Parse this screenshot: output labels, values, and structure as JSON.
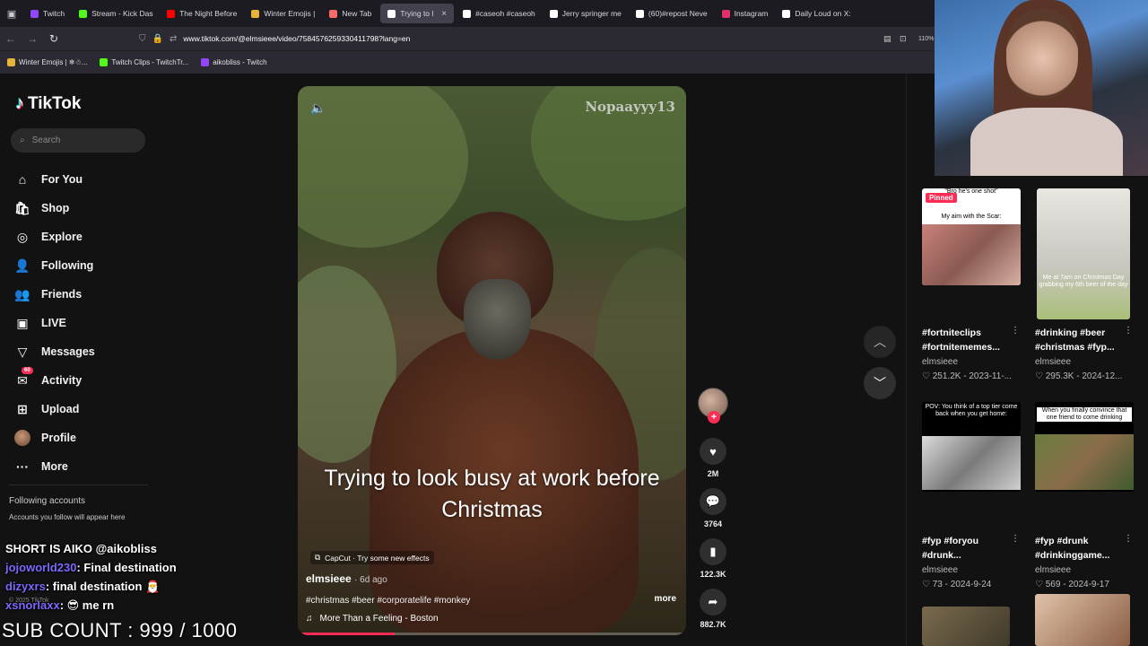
{
  "browser": {
    "tabs": [
      {
        "label": "Twitch",
        "color": "#9146ff",
        "active": false
      },
      {
        "label": "Stream - Kick Das",
        "color": "#53fc18",
        "active": false
      },
      {
        "label": "The Night Before",
        "color": "#ff0000",
        "active": false
      },
      {
        "label": "Winter Emojis |",
        "color": "#e8b339",
        "active": false
      },
      {
        "label": "New Tab",
        "color": "#ff6a6a",
        "active": false
      },
      {
        "label": "Trying to l",
        "color": "#ffffff",
        "active": true
      },
      {
        "label": "#caseoh #caseoh",
        "color": "#ffffff",
        "active": false
      },
      {
        "label": "Jerry springer me",
        "color": "#ffffff",
        "active": false
      },
      {
        "label": "(60)#repost Neve",
        "color": "#ffffff",
        "active": false
      },
      {
        "label": "Instagram",
        "color": "#e1306c",
        "active": false
      },
      {
        "label": "Daily Loud on X:",
        "color": "#ffffff",
        "active": false
      }
    ],
    "url": "www.tiktok.com/@elmsieee/video/7584576259330411798?lang=en",
    "zoom": "110%",
    "bookmarks": [
      {
        "label": "Winter Emojis | ❄☃...",
        "color": "#e8b339"
      },
      {
        "label": "Twitch Clips - TwitchTr...",
        "color": "#53fc18"
      },
      {
        "label": "aikobliss - Twitch",
        "color": "#9146ff"
      }
    ]
  },
  "tiktok": {
    "logo": "TikTok",
    "search_placeholder": "Search",
    "menu": [
      {
        "label": "For You",
        "icon": "home-icon",
        "glyph": "⌂"
      },
      {
        "label": "Shop",
        "icon": "shop-icon",
        "glyph": "🛍"
      },
      {
        "label": "Explore",
        "icon": "compass-icon",
        "glyph": "◎"
      },
      {
        "label": "Following",
        "icon": "following-icon",
        "glyph": "👤"
      },
      {
        "label": "Friends",
        "icon": "friends-icon",
        "glyph": "👥"
      },
      {
        "label": "LIVE",
        "icon": "live-icon",
        "glyph": "▣"
      },
      {
        "label": "Messages",
        "icon": "messages-icon",
        "glyph": "▽"
      },
      {
        "label": "Activity",
        "icon": "activity-icon",
        "glyph": "✉",
        "badge": "60"
      },
      {
        "label": "Upload",
        "icon": "upload-icon",
        "glyph": "⊞"
      },
      {
        "label": "Profile",
        "icon": "avatar",
        "glyph": ""
      },
      {
        "label": "More",
        "icon": "more-icon",
        "glyph": "···"
      }
    ],
    "following_title": "Following accounts",
    "following_sub": "Accounts you follow will appear here",
    "footer": "© 2025 TikTok"
  },
  "video": {
    "watermark": "Nopaayyy13",
    "caption": "Trying to look busy at work before Christmas",
    "effect": "CapCut · Try some new effects",
    "author": "elmsieee",
    "ago": "· 6d ago",
    "tags": "#christmas #beer #corporatelife #monkey",
    "more": "more",
    "music": "More Than a Feeling - Boston",
    "progress": 0.25,
    "likes": "2M",
    "comments": "3764",
    "saves": "122.3K",
    "shares": "882.7K"
  },
  "grid": [
    {
      "title": "#fortniteclips #fortnitememes...",
      "author": "elmsieee",
      "views": "251.2K",
      "date": "2023-11-...",
      "pinned": "Pinned",
      "overlay": "\"Bro he's one shot\"",
      "overlay2": "My aim with the Scar:"
    },
    {
      "title": "#drinking #beer #christmas #fyp...",
      "author": "elmsieee",
      "views": "295.3K",
      "date": "2024-12...",
      "overlay": "Me at 7am on Christmas Day grabbing my 6th beer of the day"
    },
    {
      "title": "#fyp #foryou #drunk...",
      "author": "elmsieee",
      "views": "73",
      "date": "2024-9-24",
      "overlay": "POV: You think of a top tier come back when you get home:"
    },
    {
      "title": "#fyp #drunk #drinkinggame...",
      "author": "elmsieee",
      "views": "569",
      "date": "2024-9-17",
      "overlay": "When you finally convince that one friend to come drinking"
    }
  ],
  "stream": {
    "chat": [
      {
        "name": "SHORT IS AIKO @aikobliss",
        "msg": "",
        "color": "#ffffff"
      },
      {
        "name": "jojoworld230",
        "msg": ": Final destination",
        "color": "#7a68ff"
      },
      {
        "name": "dizyxrs",
        "msg": ": final destination 🎅",
        "color": "#7a68ff"
      },
      {
        "name": "xsnorlaxx",
        "msg": ": 😎 me rn",
        "color": "#7a68ff"
      }
    ],
    "sub_count": "SUB COUNT : 999 / 1000"
  }
}
